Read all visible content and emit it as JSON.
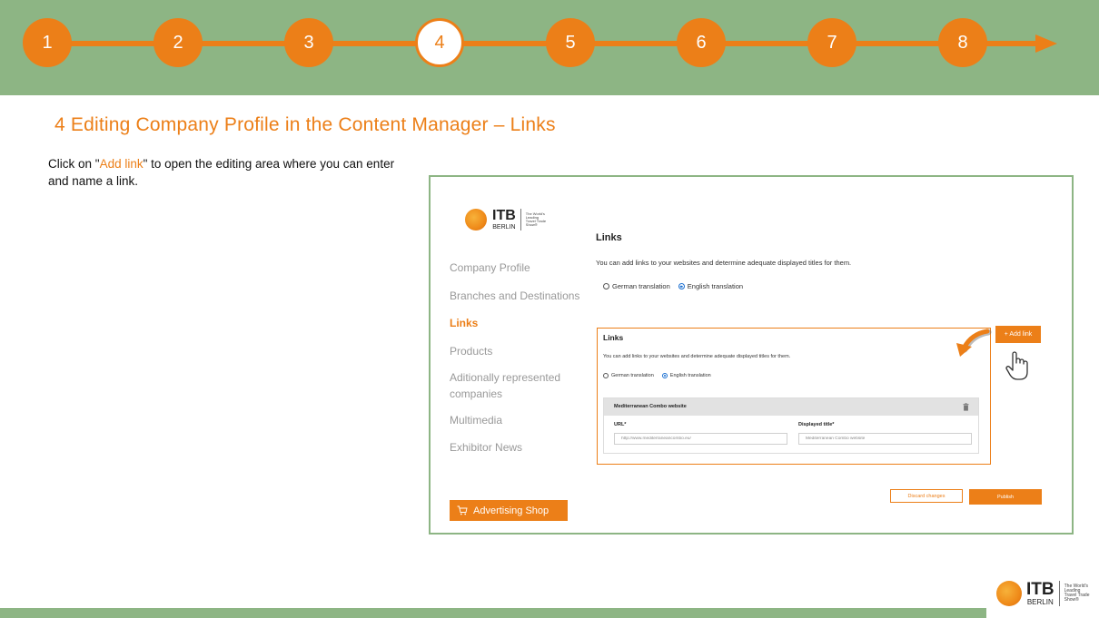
{
  "stepper": {
    "steps": [
      "1",
      "2",
      "3",
      "4",
      "5",
      "6",
      "7",
      "8"
    ],
    "active_step": "4"
  },
  "slide": {
    "title": "4 Editing Company Profile in the Content Manager – Links",
    "instruction_prefix": "Click on \"",
    "instruction_highlight": "Add link",
    "instruction_suffix": "\" to open the editing area where you can enter and name a link."
  },
  "logo": {
    "wordmark": "ITB",
    "city": "BERLIN",
    "tagline": "The World's Leading Travel Trade Show®"
  },
  "sidebar": {
    "items": [
      {
        "label": "Company Profile"
      },
      {
        "label": "Branches and Destinations"
      },
      {
        "label": "Links"
      },
      {
        "label": "Products"
      },
      {
        "label": "Aditionally represented companies"
      },
      {
        "label": "Multimedia"
      },
      {
        "label": "Exhibitor News"
      }
    ],
    "active": "Links",
    "ad_shop_label": "Advertising Shop"
  },
  "main": {
    "heading": "Links",
    "description": "You can add links to your websites and determine adequate displayed titles for them.",
    "lang_german": "German translation",
    "lang_english": "English translation",
    "selected_lang": "English translation"
  },
  "card": {
    "heading": "Links",
    "description": "You can add links to your websites and determine adequate displayed titles for them.",
    "lang_german": "German translation",
    "lang_english": "English translation",
    "entry": {
      "title": "Mediterranean Combo website",
      "url_label": "URL*",
      "url_value": "http://www.mediterraneancombo.eu/",
      "title_label": "Displayed title*",
      "title_value": "Mediterranean Combo website"
    }
  },
  "actions": {
    "add_link": "+ Add link",
    "discard": "Discard changes",
    "publish": "Publish"
  },
  "colors": {
    "accent": "#ec7f18",
    "band_green": "#8db584",
    "radio_blue": "#1a6fd1"
  }
}
